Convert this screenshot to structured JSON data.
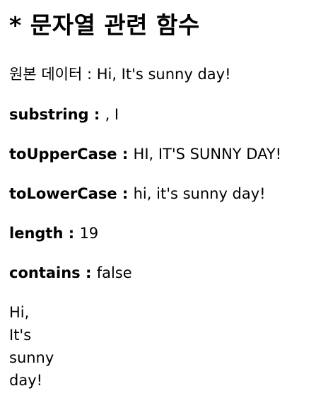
{
  "title": "* 문자열 관련 함수",
  "original": {
    "label": "원본 데이터 : ",
    "value": "Hi, It's sunny day!"
  },
  "results": [
    {
      "label": "substring : ",
      "value": ", I"
    },
    {
      "label": "toUpperCase : ",
      "value": "HI, IT'S SUNNY DAY!"
    },
    {
      "label": "toLowerCase : ",
      "value": "hi, it's sunny day!"
    },
    {
      "label": "length : ",
      "value": "19"
    },
    {
      "label": "contains : ",
      "value": "false"
    }
  ],
  "split_words": [
    "Hi,",
    "It's",
    "sunny",
    "day!"
  ]
}
